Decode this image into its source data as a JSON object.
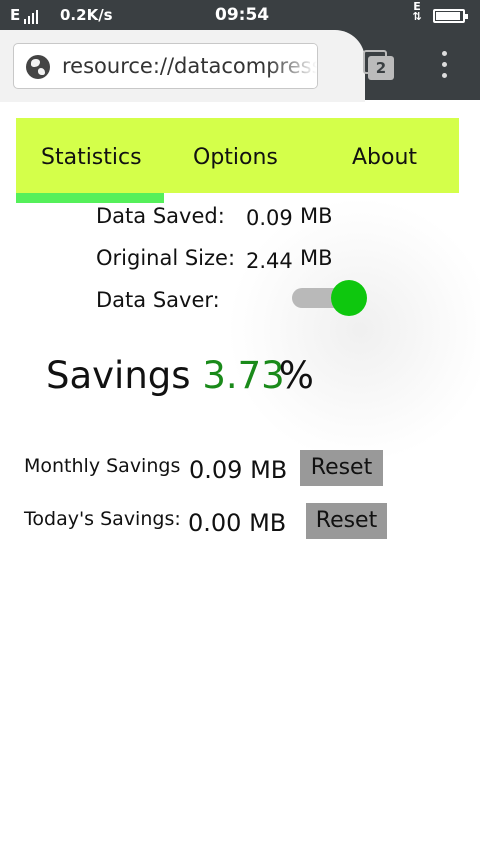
{
  "status_bar": {
    "network": "E",
    "speed": "0.2K/s",
    "time": "09:54",
    "network_secondary": "E"
  },
  "browser": {
    "url": "resource://datacompress",
    "tab_count": "2"
  },
  "nav": {
    "tabs": [
      {
        "label": "Statistics",
        "active": true
      },
      {
        "label": "Options",
        "active": false
      },
      {
        "label": "About",
        "active": false
      }
    ]
  },
  "stats": {
    "data_saved_label": "Data Saved:",
    "data_saved_value": "0.09",
    "data_saved_unit": "MB",
    "original_size_label": "Original Size:",
    "original_size_value": "2.44",
    "original_size_unit": "MB",
    "data_saver_label": "Data Saver:",
    "data_saver_on": true
  },
  "savings": {
    "label": "Savings",
    "value": "3.73",
    "suffix": "%"
  },
  "monthly": {
    "label": "Monthly Savings",
    "value": "0.09 MB",
    "button": "Reset"
  },
  "today": {
    "label": "Today's Savings:",
    "value": "0.00 MB",
    "button": "Reset"
  },
  "colors": {
    "nav_bg": "#d4ff4a",
    "active_underline": "#55f05a",
    "toggle_on": "#0ec70e",
    "savings_pct": "#1a8a1a",
    "button_bg": "#999999",
    "chrome_dark": "#3a3f42"
  }
}
